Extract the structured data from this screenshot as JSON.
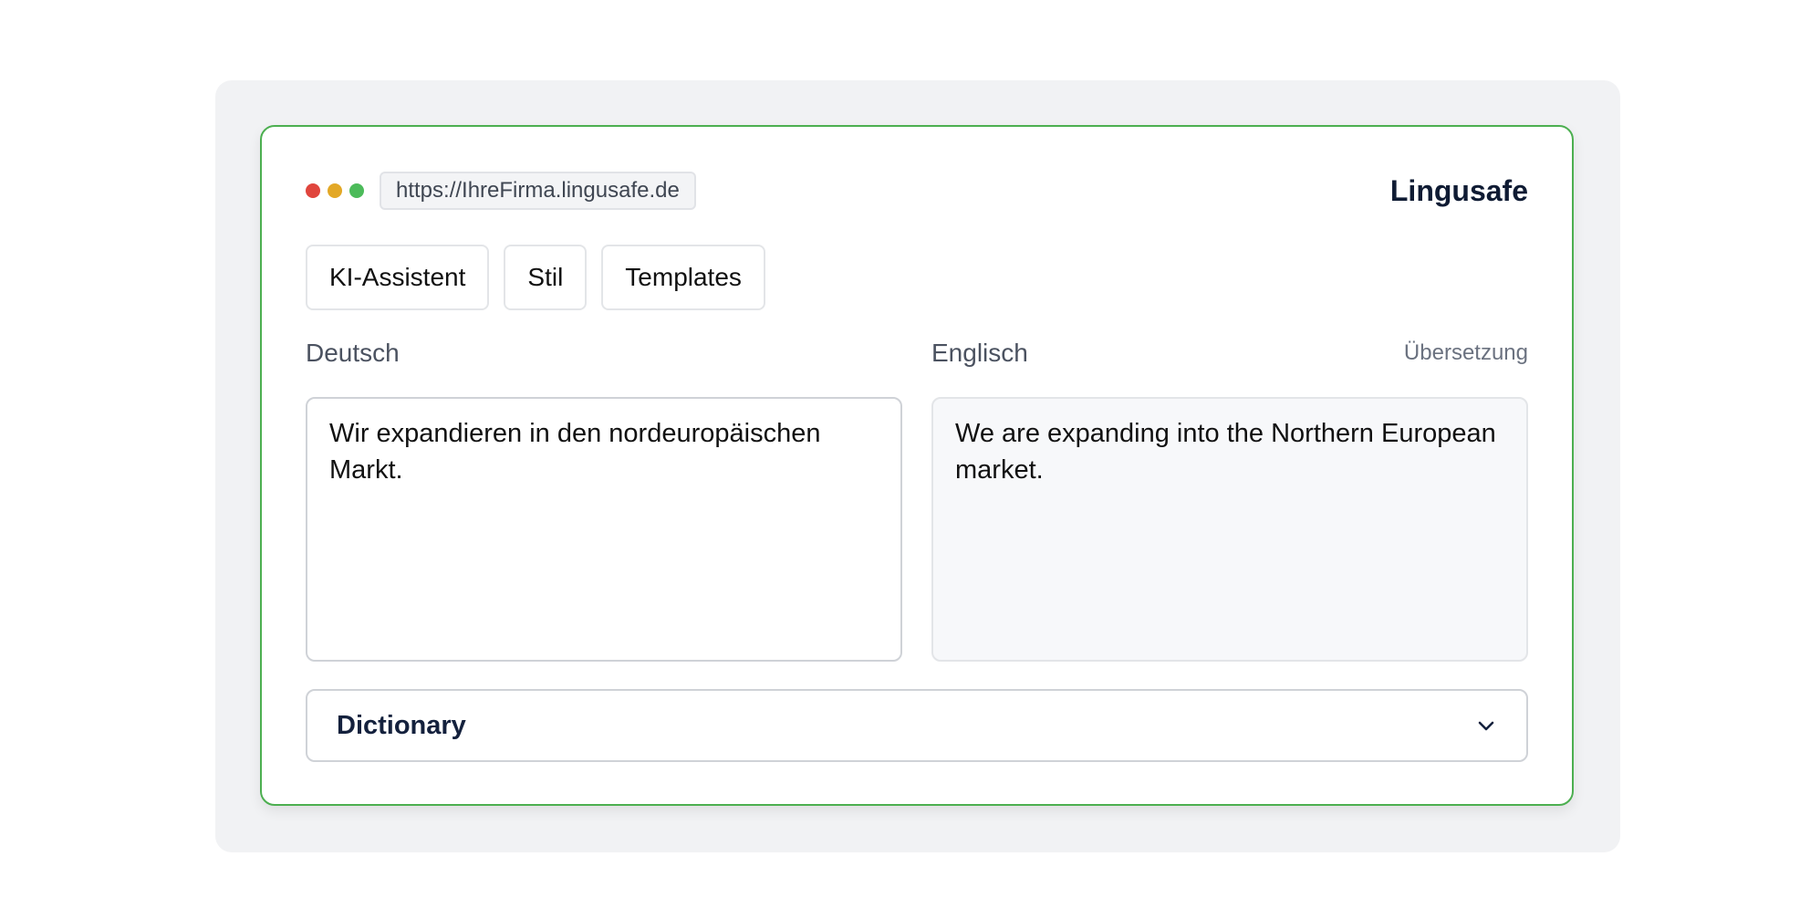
{
  "window": {
    "traffic_lights": [
      {
        "name": "close",
        "color": "#e0453d"
      },
      {
        "name": "minimize",
        "color": "#e3a826"
      },
      {
        "name": "maximize",
        "color": "#4cbb5a"
      }
    ],
    "url": "https://IhreFirma.lingusafe.de",
    "brand": "Lingusafe"
  },
  "toolbar": {
    "buttons": [
      {
        "label": "KI-Assistent"
      },
      {
        "label": "Stil"
      },
      {
        "label": "Templates"
      }
    ]
  },
  "source": {
    "language": "Deutsch",
    "text": "Wir expandieren in den nordeuropäischen Markt."
  },
  "target": {
    "language": "Englisch",
    "note": "Übersetzung",
    "text": "We are expanding into the Northern European market."
  },
  "dictionary": {
    "title": "Dictionary",
    "icon": "chevron-down-icon"
  },
  "colors": {
    "accent_border": "#4caf50",
    "brand_text": "#0f1b33",
    "panel_background": "#f1f2f4"
  }
}
